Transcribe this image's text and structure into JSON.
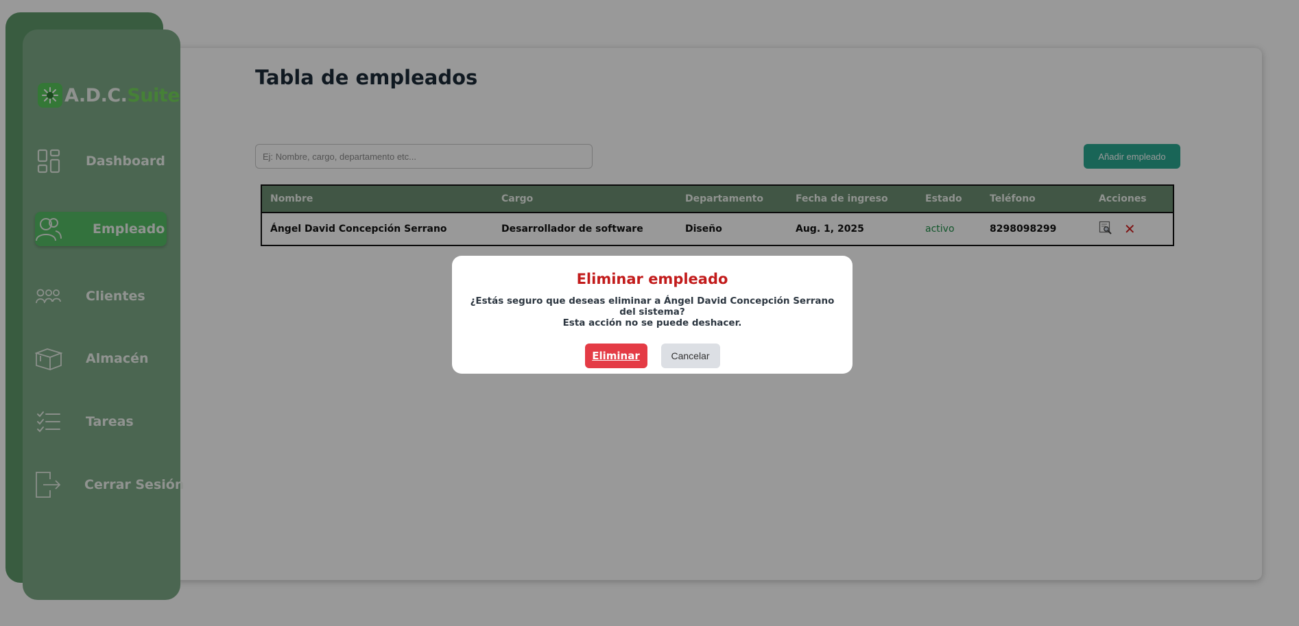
{
  "brand": {
    "name_main": "A.D.C.",
    "name_accent": "Suite",
    "icon": "sunburst-logo-icon",
    "accent_color": "#57c95a"
  },
  "sidebar": {
    "items": [
      {
        "label": "Dashboard",
        "icon": "dashboard-grid-icon",
        "active": false
      },
      {
        "label": "Empleado",
        "icon": "users-icon",
        "active": true
      },
      {
        "label": "Clientes",
        "icon": "group-icon",
        "active": false
      },
      {
        "label": "Almacén",
        "icon": "box-icon",
        "active": false
      },
      {
        "label": "Tareas",
        "icon": "checklist-icon",
        "active": false
      },
      {
        "label": "Cerrar Sesión",
        "icon": "logout-icon",
        "active": false
      }
    ]
  },
  "main": {
    "title": "Tabla de empleados",
    "search": {
      "placeholder": "Ej: Nombre, cargo, departamento etc...",
      "value": ""
    },
    "add_button_label": "Añadir empleado",
    "table": {
      "columns": [
        "Nombre",
        "Cargo",
        "Departamento",
        "Fecha de ingreso",
        "Estado",
        "Teléfono",
        "Acciones"
      ],
      "rows": [
        {
          "nombre": "Ángel David Concepción Serrano",
          "cargo": "Desarrollador de software",
          "departamento": "Diseño",
          "fecha": "Aug. 1, 2025",
          "estado": "activo",
          "telefono": "8298098299",
          "actions": [
            "view-details-icon",
            "close-icon"
          ]
        }
      ]
    }
  },
  "modal": {
    "title": "Eliminar empleado",
    "message_line1": "¿Estás seguro que deseas eliminar a Ángel David Concepción Serrano del sistema?",
    "message_line2": "Esta acción no se puede deshacer.",
    "confirm_label": "Eliminar",
    "cancel_label": "Cancelar",
    "confirm_color": "#e43b45",
    "title_color": "#c21b1b"
  },
  "colors": {
    "sidebar": "#7dab87",
    "sidebar_active": "#56bf66",
    "table_header": "#6d8f73",
    "add_button": "#2aa892",
    "estado_active": "#1f8f49"
  }
}
